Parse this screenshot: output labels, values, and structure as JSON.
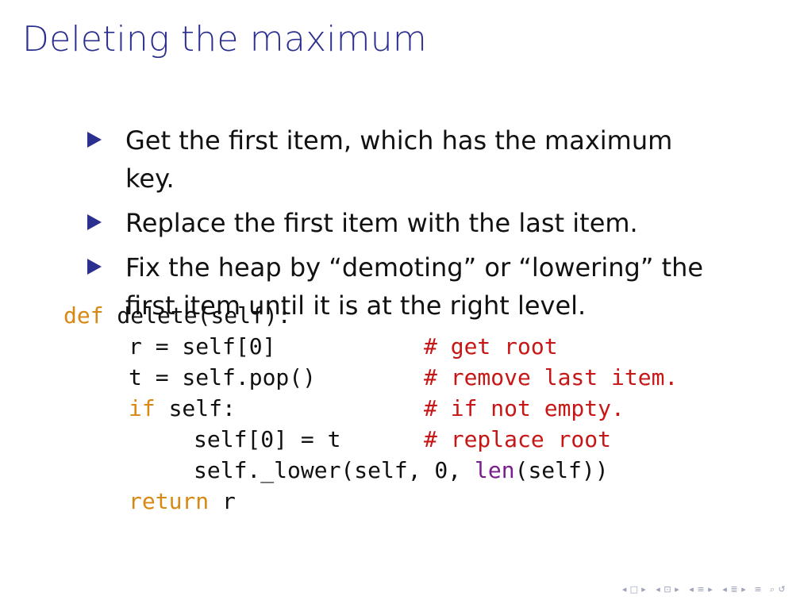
{
  "slide": {
    "title": "Deleting the maximum",
    "bullets": [
      "Get the first item, which has the maximum key.",
      "Replace the first item with the last item.",
      "Fix the heap by “demoting” or “lowering” the first item until it is at the right level."
    ]
  },
  "code": {
    "lines": [
      {
        "indent": 0,
        "tokens": [
          {
            "text": "def",
            "kind": "keyword"
          },
          {
            "text": " delete(self):",
            "kind": "plain"
          }
        ]
      },
      {
        "indent": 1,
        "tokens": [
          {
            "text": "r = self[0]",
            "kind": "plain"
          }
        ],
        "comment": "# get root"
      },
      {
        "indent": 1,
        "tokens": [
          {
            "text": "t = self.pop()",
            "kind": "plain"
          }
        ],
        "comment": "# remove last item."
      },
      {
        "indent": 1,
        "tokens": [
          {
            "text": "if",
            "kind": "keyword"
          },
          {
            "text": " self:",
            "kind": "plain"
          }
        ],
        "comment": "# if not empty."
      },
      {
        "indent": 2,
        "tokens": [
          {
            "text": "self[0] = t",
            "kind": "plain"
          }
        ],
        "comment": "# replace root"
      },
      {
        "indent": 2,
        "tokens": [
          {
            "text": "self._lower(self, 0, ",
            "kind": "plain"
          },
          {
            "text": "len",
            "kind": "builtin"
          },
          {
            "text": "(self))",
            "kind": "plain"
          }
        ]
      },
      {
        "indent": 1,
        "tokens": [
          {
            "text": "return",
            "kind": "keyword"
          },
          {
            "text": " r",
            "kind": "plain"
          }
        ]
      }
    ]
  },
  "navigation": {
    "icons": [
      {
        "name": "nav-prev-frame-icon",
        "glyph": "◂"
      },
      {
        "name": "nav-frame-icon",
        "glyph": "□"
      },
      {
        "name": "nav-next-frame-icon",
        "glyph": "▸"
      },
      {
        "name": "nav-prev-subsection-icon",
        "glyph": "◂"
      },
      {
        "name": "nav-subsection-icon",
        "glyph": "⊡"
      },
      {
        "name": "nav-next-subsection-icon",
        "glyph": "▸"
      },
      {
        "name": "nav-prev-section-icon",
        "glyph": "◂"
      },
      {
        "name": "nav-section-icon",
        "glyph": "≡"
      },
      {
        "name": "nav-next-section-icon",
        "glyph": "▸"
      },
      {
        "name": "nav-prev-slide-group-icon",
        "glyph": "◂"
      },
      {
        "name": "nav-slide-group-icon",
        "glyph": "≣"
      },
      {
        "name": "nav-next-slide-group-icon",
        "glyph": "▸"
      },
      {
        "name": "nav-appendix-icon",
        "glyph": "≡"
      },
      {
        "name": "nav-search-icon",
        "glyph": "⌕"
      },
      {
        "name": "nav-back-icon",
        "glyph": "↺"
      }
    ]
  },
  "colors": {
    "title": "#2b2f8f",
    "bullet": "#2b2f8f",
    "keyword": "#d88913",
    "comment": "#c71616",
    "builtin": "#7a1e8e",
    "nav": "#9aa0b8"
  }
}
